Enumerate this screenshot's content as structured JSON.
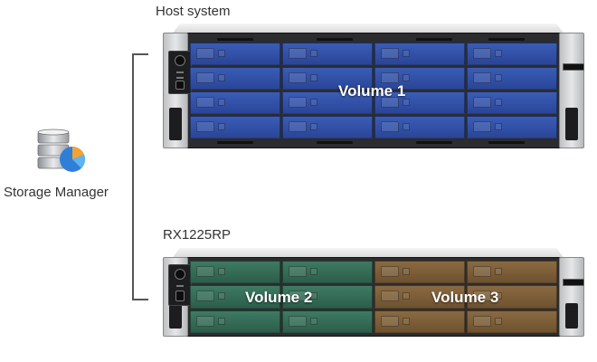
{
  "diagram": {
    "host_label": "Host system",
    "expansion_label": "RX1225RP",
    "manager_label": "Storage Manager",
    "icons": {
      "manager": "storage-manager-icon",
      "bracket": "connector-bracket"
    },
    "volumes": [
      {
        "name": "Volume 1",
        "color": "#2f4fa6"
      },
      {
        "name": "Volume 2",
        "color": "#346b55"
      },
      {
        "name": "Volume 3",
        "color": "#7c5e38"
      }
    ],
    "host_bays": {
      "rows": 4,
      "cols": 4
    },
    "expansion_bays": {
      "rows": 3,
      "cols": 4
    }
  }
}
